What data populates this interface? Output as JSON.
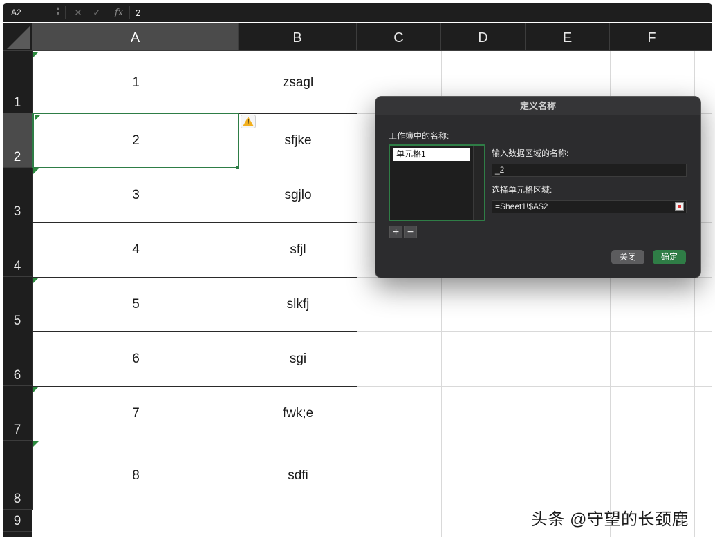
{
  "formula_bar": {
    "name_box": "A2",
    "cancel_icon": "✕",
    "confirm_icon": "✓",
    "fx_label": "fx",
    "formula_value": "2"
  },
  "columns": [
    "A",
    "B",
    "C",
    "D",
    "E",
    "F"
  ],
  "rows": [
    "1",
    "2",
    "3",
    "4",
    "5",
    "6",
    "7",
    "8",
    "9"
  ],
  "cells": {
    "a": [
      "1",
      "2",
      "3",
      "4",
      "5",
      "6",
      "7",
      "8"
    ],
    "b": [
      "zsagl",
      "sfjke",
      "sgjlo",
      "sfjl",
      "slkfj",
      "sgi",
      "fwk;e",
      "sdfi"
    ]
  },
  "active_cell": "A2",
  "dialog": {
    "title": "定义名称",
    "workbook_names_label": "工作簿中的名称:",
    "names": [
      "单元格1"
    ],
    "add_label": "+",
    "remove_label": "−",
    "name_field_label": "输入数据区域的名称:",
    "name_field_value": "_2",
    "range_field_label": "选择单元格区域:",
    "range_field_value": "=Sheet1!$A$2",
    "close_button": "关闭",
    "ok_button": "确定"
  },
  "watermark": "头条 @守望的长颈鹿",
  "colors": {
    "accent_green": "#2f7d46",
    "header_dark": "#1e1e1e",
    "header_selected": "#4b4b4b",
    "dialog_bg": "#2c2c2e"
  }
}
